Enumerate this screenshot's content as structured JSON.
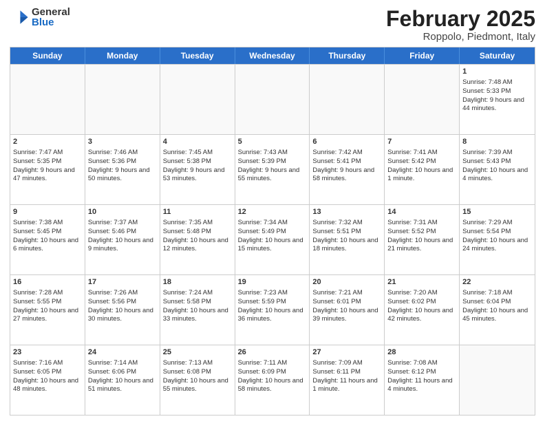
{
  "logo": {
    "general": "General",
    "blue": "Blue"
  },
  "header": {
    "month": "February 2025",
    "location": "Roppolo, Piedmont, Italy"
  },
  "weekdays": [
    "Sunday",
    "Monday",
    "Tuesday",
    "Wednesday",
    "Thursday",
    "Friday",
    "Saturday"
  ],
  "rows": [
    [
      {
        "day": "",
        "info": ""
      },
      {
        "day": "",
        "info": ""
      },
      {
        "day": "",
        "info": ""
      },
      {
        "day": "",
        "info": ""
      },
      {
        "day": "",
        "info": ""
      },
      {
        "day": "",
        "info": ""
      },
      {
        "day": "1",
        "info": "Sunrise: 7:48 AM\nSunset: 5:33 PM\nDaylight: 9 hours and 44 minutes."
      }
    ],
    [
      {
        "day": "2",
        "info": "Sunrise: 7:47 AM\nSunset: 5:35 PM\nDaylight: 9 hours and 47 minutes."
      },
      {
        "day": "3",
        "info": "Sunrise: 7:46 AM\nSunset: 5:36 PM\nDaylight: 9 hours and 50 minutes."
      },
      {
        "day": "4",
        "info": "Sunrise: 7:45 AM\nSunset: 5:38 PM\nDaylight: 9 hours and 53 minutes."
      },
      {
        "day": "5",
        "info": "Sunrise: 7:43 AM\nSunset: 5:39 PM\nDaylight: 9 hours and 55 minutes."
      },
      {
        "day": "6",
        "info": "Sunrise: 7:42 AM\nSunset: 5:41 PM\nDaylight: 9 hours and 58 minutes."
      },
      {
        "day": "7",
        "info": "Sunrise: 7:41 AM\nSunset: 5:42 PM\nDaylight: 10 hours and 1 minute."
      },
      {
        "day": "8",
        "info": "Sunrise: 7:39 AM\nSunset: 5:43 PM\nDaylight: 10 hours and 4 minutes."
      }
    ],
    [
      {
        "day": "9",
        "info": "Sunrise: 7:38 AM\nSunset: 5:45 PM\nDaylight: 10 hours and 6 minutes."
      },
      {
        "day": "10",
        "info": "Sunrise: 7:37 AM\nSunset: 5:46 PM\nDaylight: 10 hours and 9 minutes."
      },
      {
        "day": "11",
        "info": "Sunrise: 7:35 AM\nSunset: 5:48 PM\nDaylight: 10 hours and 12 minutes."
      },
      {
        "day": "12",
        "info": "Sunrise: 7:34 AM\nSunset: 5:49 PM\nDaylight: 10 hours and 15 minutes."
      },
      {
        "day": "13",
        "info": "Sunrise: 7:32 AM\nSunset: 5:51 PM\nDaylight: 10 hours and 18 minutes."
      },
      {
        "day": "14",
        "info": "Sunrise: 7:31 AM\nSunset: 5:52 PM\nDaylight: 10 hours and 21 minutes."
      },
      {
        "day": "15",
        "info": "Sunrise: 7:29 AM\nSunset: 5:54 PM\nDaylight: 10 hours and 24 minutes."
      }
    ],
    [
      {
        "day": "16",
        "info": "Sunrise: 7:28 AM\nSunset: 5:55 PM\nDaylight: 10 hours and 27 minutes."
      },
      {
        "day": "17",
        "info": "Sunrise: 7:26 AM\nSunset: 5:56 PM\nDaylight: 10 hours and 30 minutes."
      },
      {
        "day": "18",
        "info": "Sunrise: 7:24 AM\nSunset: 5:58 PM\nDaylight: 10 hours and 33 minutes."
      },
      {
        "day": "19",
        "info": "Sunrise: 7:23 AM\nSunset: 5:59 PM\nDaylight: 10 hours and 36 minutes."
      },
      {
        "day": "20",
        "info": "Sunrise: 7:21 AM\nSunset: 6:01 PM\nDaylight: 10 hours and 39 minutes."
      },
      {
        "day": "21",
        "info": "Sunrise: 7:20 AM\nSunset: 6:02 PM\nDaylight: 10 hours and 42 minutes."
      },
      {
        "day": "22",
        "info": "Sunrise: 7:18 AM\nSunset: 6:04 PM\nDaylight: 10 hours and 45 minutes."
      }
    ],
    [
      {
        "day": "23",
        "info": "Sunrise: 7:16 AM\nSunset: 6:05 PM\nDaylight: 10 hours and 48 minutes."
      },
      {
        "day": "24",
        "info": "Sunrise: 7:14 AM\nSunset: 6:06 PM\nDaylight: 10 hours and 51 minutes."
      },
      {
        "day": "25",
        "info": "Sunrise: 7:13 AM\nSunset: 6:08 PM\nDaylight: 10 hours and 55 minutes."
      },
      {
        "day": "26",
        "info": "Sunrise: 7:11 AM\nSunset: 6:09 PM\nDaylight: 10 hours and 58 minutes."
      },
      {
        "day": "27",
        "info": "Sunrise: 7:09 AM\nSunset: 6:11 PM\nDaylight: 11 hours and 1 minute."
      },
      {
        "day": "28",
        "info": "Sunrise: 7:08 AM\nSunset: 6:12 PM\nDaylight: 11 hours and 4 minutes."
      },
      {
        "day": "",
        "info": ""
      }
    ]
  ]
}
